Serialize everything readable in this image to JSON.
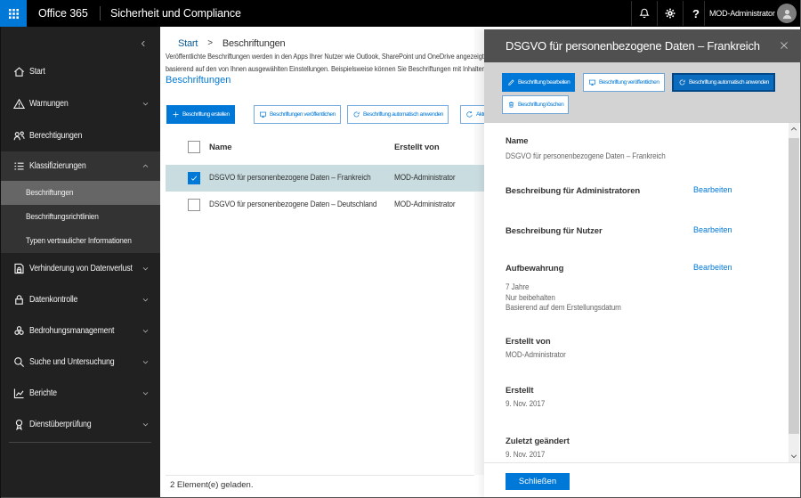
{
  "colors": {
    "accent": "#0078d7",
    "topbar_bg": "#000000",
    "sidebar_bg": "#212121",
    "sidebar_section_bg": "#333333",
    "sidebar_selected_bg": "#666666",
    "selected_row_bg": "#c9dde1",
    "panel_header_bg": "#505050",
    "panel_toolbar_bg": "#d3d3d3",
    "focus_button_bg": "#0a6cbe",
    "focus_button_border": "#004888",
    "breadcrumb_link": "#0c5a93"
  },
  "topbar": {
    "brand": "Office 365",
    "app_title": "Sicherheit und Compliance",
    "user_name": "MOD-Administrator"
  },
  "sidebar": {
    "items": [
      {
        "label": "Start",
        "icon": "home",
        "expandable": false
      },
      {
        "label": "Warnungen",
        "icon": "warning",
        "expandable": true
      },
      {
        "label": "Berechtigungen",
        "icon": "permissions",
        "expandable": false
      },
      {
        "label": "Klassifizierungen",
        "icon": "classifications",
        "expandable": true,
        "expanded": true,
        "children": [
          {
            "label": "Beschriftungen",
            "selected": true
          },
          {
            "label": "Beschriftungsrichtlinien",
            "selected": false
          },
          {
            "label": "Typen vertraulicher Informationen",
            "selected": false
          }
        ]
      },
      {
        "label": "Verhinderung von Datenverlust",
        "icon": "dlp",
        "expandable": true
      },
      {
        "label": "Datenkontrolle",
        "icon": "lock",
        "expandable": true
      },
      {
        "label": "Bedrohungsmanagement",
        "icon": "biohazard",
        "expandable": true
      },
      {
        "label": "Suche und Untersuchung",
        "icon": "search",
        "expandable": true
      },
      {
        "label": "Berichte",
        "icon": "chart",
        "expandable": true
      },
      {
        "label": "Dienstüberprüfung",
        "icon": "badge",
        "expandable": true
      }
    ]
  },
  "main": {
    "breadcrumb": {
      "root": "Start",
      "separator": ">",
      "current": "Beschriftungen"
    },
    "intro_line1": "Veröffentlichte Beschriftungen werden in den Apps Ihrer Nutzer wie Outlook, SharePoint und OneDrive angezeigt,",
    "intro_line2": "basierend auf den von Ihnen ausgewählten Einstellungen. Beispielsweise können Sie Beschriftungen mit Inhalten",
    "intro_link": "Beschriftungen",
    "toolbar": [
      {
        "label": "Beschriftung erstellen",
        "icon": "plus",
        "style": "primary"
      },
      {
        "label": "Beschriftungen veröffentlichen",
        "icon": "publish",
        "style": "outline"
      },
      {
        "label": "Beschriftung automatisch anwenden",
        "icon": "autoapply",
        "style": "outline"
      },
      {
        "label": "Aktualisieren",
        "icon": "refresh",
        "style": "outline"
      }
    ],
    "table": {
      "columns": [
        "Name",
        "Erstellt von"
      ],
      "rows": [
        {
          "name": "DSGVO für personenbezogene Daten – Frankreich",
          "created_by": "MOD-Administrator",
          "selected": true
        },
        {
          "name": "DSGVO für personenbezogene Daten – Deutschland",
          "created_by": "MOD-Administrator",
          "selected": false
        }
      ]
    },
    "status": "2 Element(e) geladen."
  },
  "panel": {
    "title": "DSGVO für personenbezogene Daten – Frankreich",
    "actions": [
      {
        "label": "Beschriftung bearbeiten",
        "icon": "edit",
        "style": "primary"
      },
      {
        "label": "Beschriftung veröffentlichen",
        "icon": "publish",
        "style": "outline"
      },
      {
        "label": "Beschriftung automatisch anwenden",
        "icon": "autoapply",
        "style": "focus"
      },
      {
        "label": "Beschriftung löschen",
        "icon": "trash",
        "style": "outline"
      }
    ],
    "sections": [
      {
        "label": "Name",
        "action": "",
        "values": [
          "DSGVO für personenbezogene Daten – Frankreich"
        ]
      },
      {
        "label": "Beschreibung für Administratoren",
        "action": "Bearbeiten",
        "values": []
      },
      {
        "label": "Beschreibung für Nutzer",
        "action": "Bearbeiten",
        "values": []
      },
      {
        "label": "Aufbewahrung",
        "action": "Bearbeiten",
        "values": [
          "7 Jahre",
          "Nur beibehalten",
          "Basierend auf dem Erstellungsdatum"
        ]
      },
      {
        "label": "Erstellt von",
        "action": "",
        "values": [
          "MOD-Administrator"
        ]
      },
      {
        "label": "Erstellt",
        "action": "",
        "values": [
          "9. Nov. 2017"
        ]
      },
      {
        "label": "Zuletzt geändert",
        "action": "",
        "values": [
          "9. Nov. 2017"
        ]
      }
    ],
    "close_button": "Schließen"
  }
}
